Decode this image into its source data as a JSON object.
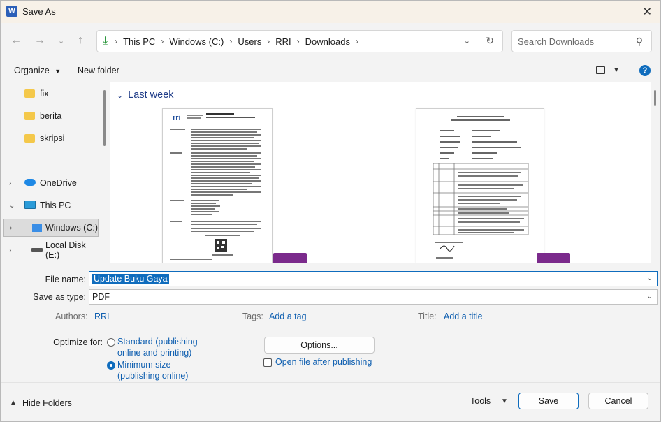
{
  "window": {
    "title": "Save As",
    "app_icon": "W"
  },
  "nav": {
    "breadcrumbs": [
      "This PC",
      "Windows (C:)",
      "Users",
      "RRI",
      "Downloads"
    ],
    "search_placeholder": "Search Downloads"
  },
  "commands": {
    "organize": "Organize",
    "new_folder": "New folder",
    "help": "?"
  },
  "sidebar": {
    "items": [
      {
        "label": "fix",
        "icon": "folder-icon"
      },
      {
        "label": "berita",
        "icon": "folder-icon"
      },
      {
        "label": "skripsi",
        "icon": "folder-icon"
      },
      {
        "label": "OneDrive",
        "icon": "cloud-icon"
      },
      {
        "label": "This PC",
        "icon": "pc-icon"
      },
      {
        "label": "Windows (C:)",
        "icon": "drive-icon"
      },
      {
        "label": "Local Disk (E:)",
        "icon": "disk-icon"
      }
    ]
  },
  "main": {
    "group_header": "Last week"
  },
  "form": {
    "file_name_label": "File name:",
    "file_name_value": "Update Buku Gaya",
    "save_type_label": "Save as type:",
    "save_type_value": "PDF",
    "authors_label": "Authors:",
    "authors_value": "RRI",
    "tags_label": "Tags:",
    "tags_value": "Add a tag",
    "title_label": "Title:",
    "title_value": "Add a title",
    "optimize_label": "Optimize for:",
    "option_standard_line1": "Standard (publishing",
    "option_standard_line2": "online and printing)",
    "option_minimum_line1": "Minimum size",
    "option_minimum_line2": "(publishing online)",
    "options_button": "Options...",
    "open_after_label": "Open file after publishing"
  },
  "footer": {
    "hide_folders": "Hide Folders",
    "tools": "Tools",
    "save": "Save",
    "cancel": "Cancel"
  },
  "colors": {
    "accent": "#0f6cbd",
    "link": "#0f5fb0",
    "folder": "#f4c84a",
    "pdf_badge": "#7b2a8c"
  }
}
